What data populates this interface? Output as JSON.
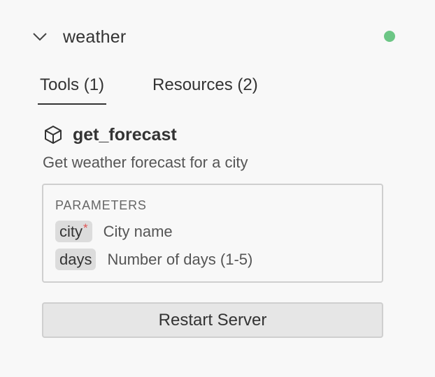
{
  "server": {
    "name": "weather",
    "status_color": "#6cc685",
    "expand_icon": "chevron-down-icon"
  },
  "tabs": [
    {
      "label": "Tools (1)",
      "active": true
    },
    {
      "label": "Resources (2)",
      "active": false
    }
  ],
  "tool": {
    "icon": "cube-icon",
    "name": "get_forecast",
    "description": "Get weather forecast for a city"
  },
  "parameters": {
    "title": "PARAMETERS",
    "items": [
      {
        "name": "city",
        "required_marker": "*",
        "description": "City name"
      },
      {
        "name": "days",
        "required_marker": "",
        "description": "Number of days (1-5)"
      }
    ]
  },
  "actions": {
    "restart_label": "Restart Server"
  },
  "colors": {
    "background": "#f8f8f8",
    "status_dot": "#6cc685",
    "required_star": "#e05252"
  }
}
